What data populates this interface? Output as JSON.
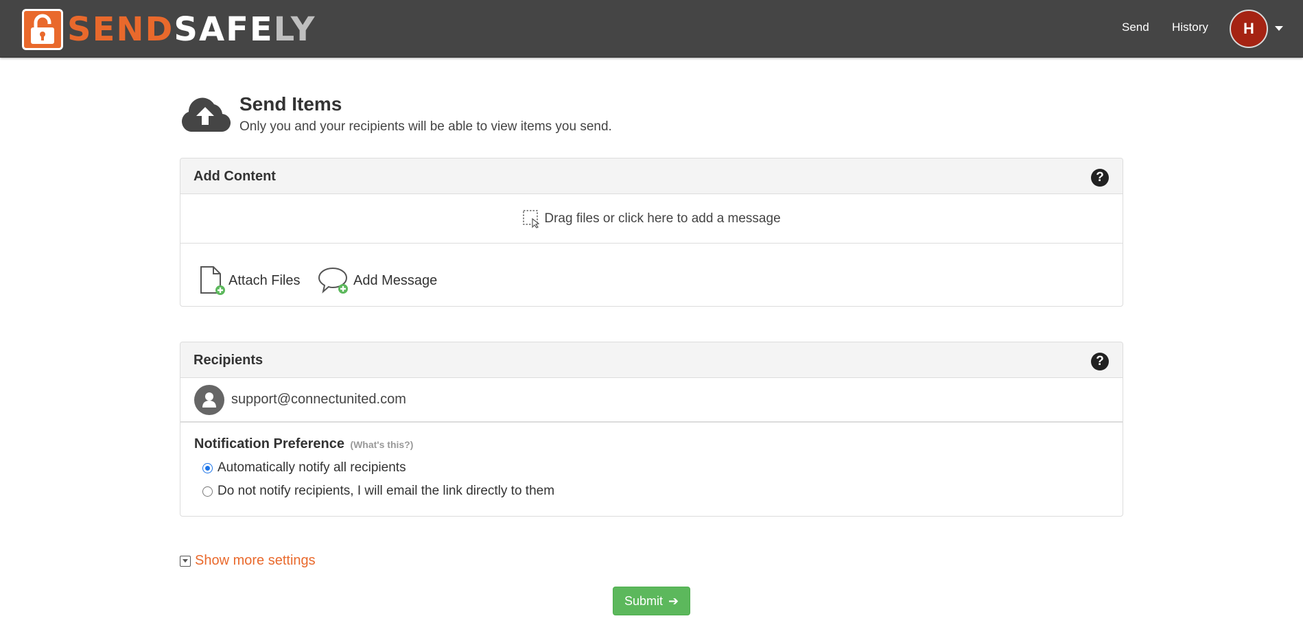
{
  "navbar": {
    "brand": {
      "send": "SEND",
      "safe": "SAFE",
      "ly": "LY"
    },
    "links": {
      "send": "Send",
      "history": "History"
    },
    "avatar_initial": "H",
    "colors": {
      "bar": "#454545",
      "brand_orange": "#e9692c",
      "avatar": "#a52313"
    }
  },
  "header": {
    "title": "Send Items",
    "subtitle": "Only you and your recipients will be able to view items you send."
  },
  "add_content": {
    "title": "Add Content",
    "help": "?",
    "dropzone_text": "Drag files or click here to add a message",
    "attach_label": "Attach Files",
    "message_label": "Add Message"
  },
  "recipients": {
    "title": "Recipients",
    "help": "?",
    "list": [
      {
        "email": "support@connectunited.com"
      }
    ],
    "notification": {
      "title": "Notification Preference",
      "whats_this": "(What's this?)",
      "options": [
        {
          "label": "Automatically notify all recipients",
          "selected": true
        },
        {
          "label": "Do not notify recipients, I will email the link directly to them",
          "selected": false
        }
      ]
    }
  },
  "more_settings_label": "Show more settings",
  "submit_label": "Submit",
  "submit_color": "#5cb85c"
}
